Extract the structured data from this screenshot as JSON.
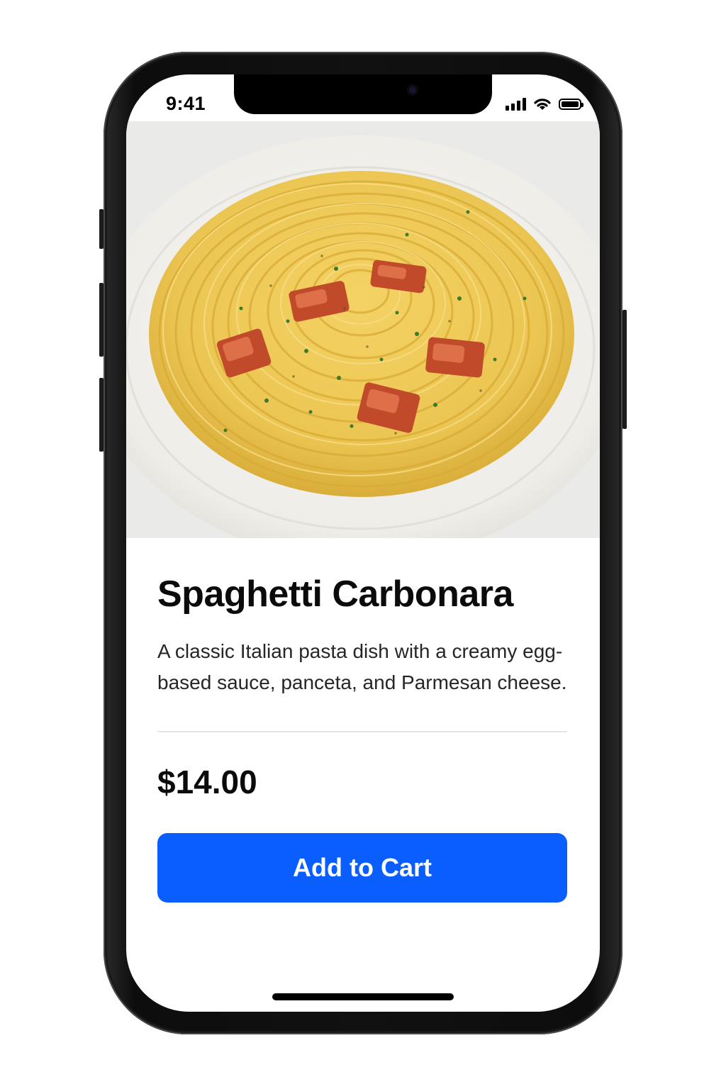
{
  "status_bar": {
    "time": "9:41",
    "icons": [
      "cellular-signal-icon",
      "wifi-icon",
      "battery-icon"
    ]
  },
  "product": {
    "image": "spaghetti-carbonara-photo",
    "title": "Spaghetti Carbonara",
    "description": "A classic Italian pasta dish with a creamy egg-based sauce, panceta, and Parmesan cheese.",
    "price": "$14.00"
  },
  "actions": {
    "add_to_cart_label": "Add to Cart"
  },
  "colors": {
    "accent": "#0a5efe",
    "text": "#0b0b0b",
    "background": "#ffffff"
  }
}
